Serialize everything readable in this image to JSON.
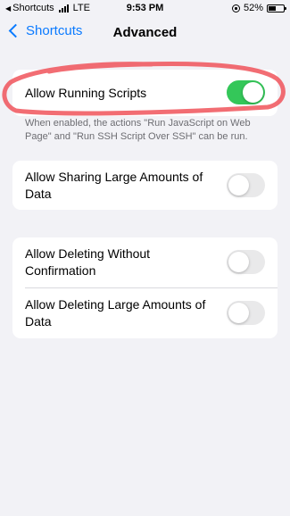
{
  "status_bar": {
    "back_app": "Shortcuts",
    "carrier": "LTE",
    "time": "9:53 PM",
    "battery_percent": "52%",
    "battery_level": 0.52
  },
  "nav": {
    "back_label": "Shortcuts",
    "title": "Advanced"
  },
  "groups": [
    {
      "rows": [
        {
          "label": "Allow Running Scripts",
          "on": true
        }
      ],
      "footer": "When enabled, the actions \"Run JavaScript on Web Page\" and \"Run SSH Script Over SSH\" can be run."
    },
    {
      "rows": [
        {
          "label": "Allow Sharing Large Amounts of Data",
          "on": false
        }
      ]
    },
    {
      "rows": [
        {
          "label": "Allow Deleting Without Confirmation",
          "on": false
        },
        {
          "label": "Allow Deleting Large Amounts of Data",
          "on": false
        }
      ]
    }
  ],
  "colors": {
    "accent": "#0a7aff",
    "toggle_on": "#34c759",
    "annotation": "#f0535b"
  }
}
